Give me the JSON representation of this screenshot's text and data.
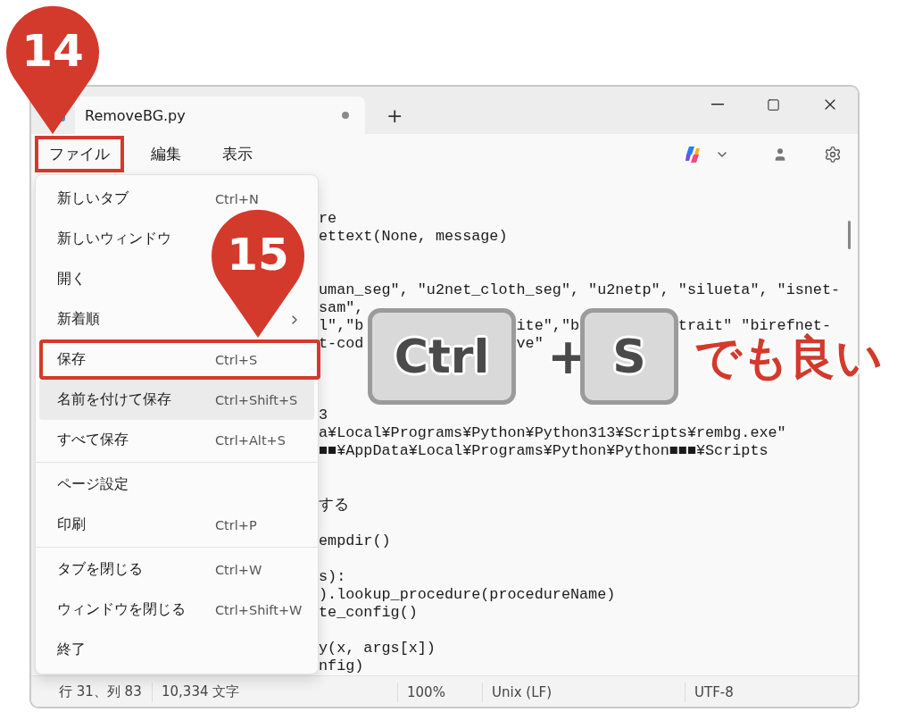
{
  "window": {
    "tab": {
      "title": "RemoveBG.py",
      "unsaved": true
    },
    "new_tab": "+"
  },
  "menubar": [
    {
      "label": "ファイル",
      "outlined": true
    },
    {
      "label": "編集",
      "outlined": false
    },
    {
      "label": "表示",
      "outlined": false
    }
  ],
  "file_menu": {
    "items": [
      {
        "kind": "item",
        "label": "新しいタブ",
        "shortcut": "Ctrl+N",
        "hovered": false,
        "outlined": false,
        "submenu": false
      },
      {
        "kind": "item",
        "label": "新しいウィンドウ",
        "hovered": false,
        "outlined": false,
        "submenu": false
      },
      {
        "kind": "item",
        "label": "開く",
        "hovered": false,
        "outlined": false,
        "submenu": false
      },
      {
        "kind": "item",
        "label": "新着順",
        "hovered": false,
        "outlined": false,
        "submenu": true
      },
      {
        "kind": "item",
        "label": "保存",
        "shortcut": "Ctrl+S",
        "hovered": false,
        "outlined": true,
        "submenu": false
      },
      {
        "kind": "item",
        "label": "名前を付けて保存",
        "shortcut": "Ctrl+Shift+S",
        "hovered": true,
        "outlined": false,
        "submenu": false
      },
      {
        "kind": "item",
        "label": "すべて保存",
        "shortcut": "Ctrl+Alt+S",
        "hovered": false,
        "outlined": false,
        "submenu": false
      },
      {
        "kind": "separator"
      },
      {
        "kind": "item",
        "label": "ページ設定",
        "hovered": false,
        "outlined": false,
        "submenu": false
      },
      {
        "kind": "item",
        "label": "印刷",
        "shortcut": "Ctrl+P",
        "hovered": false,
        "outlined": false,
        "submenu": false
      },
      {
        "kind": "separator"
      },
      {
        "kind": "item",
        "label": "タブを閉じる",
        "shortcut": "Ctrl+W",
        "hovered": false,
        "outlined": false,
        "submenu": false
      },
      {
        "kind": "item",
        "label": "ウィンドウを閉じる",
        "shortcut": "Ctrl+Shift+W",
        "hovered": false,
        "outlined": false,
        "submenu": false
      },
      {
        "kind": "item",
        "label": "終了",
        "hovered": false,
        "outlined": false,
        "submenu": false
      }
    ]
  },
  "editor": {
    "lines": [
      {
        "kind": "code",
        "text": "re"
      },
      {
        "kind": "code",
        "text": "ettext(None, message)"
      },
      {
        "kind": "blank"
      },
      {
        "kind": "blank"
      },
      {
        "kind": "code",
        "text": "uman_seg\", \"u2net_cloth_seg\", \"u2netp\", \"silueta\", \"isnet-"
      },
      {
        "kind": "code",
        "text": "sam\","
      },
      {
        "kind": "code",
        "text": "l\",\"b                 ite\",\"b           trait\" \"birefnet-"
      },
      {
        "kind": "code",
        "text": "t-cod                 ve\""
      },
      {
        "kind": "blank"
      },
      {
        "kind": "blank"
      },
      {
        "kind": "blank"
      },
      {
        "kind": "code",
        "text": "3"
      },
      {
        "kind": "code",
        "text": "a¥Local¥Programs¥Python¥Python313¥Scripts¥rembg.exe\""
      },
      {
        "kind": "code",
        "text": "■■¥AppData¥Local¥Programs¥Python¥Python■■■¥Scripts"
      },
      {
        "kind": "blank"
      },
      {
        "kind": "blank"
      },
      {
        "kind": "code",
        "text": "する"
      },
      {
        "kind": "blank"
      },
      {
        "kind": "code",
        "text": "empdir()"
      },
      {
        "kind": "blank"
      },
      {
        "kind": "code",
        "text": "s):"
      },
      {
        "kind": "code",
        "text": ").lookup_procedure(procedureName)"
      },
      {
        "kind": "code",
        "text": "te_config()"
      },
      {
        "kind": "blank"
      },
      {
        "kind": "code",
        "text": "y(x, args[x])"
      },
      {
        "kind": "code",
        "text": "nfig)"
      }
    ]
  },
  "status_bar": [
    "行 31、列 83",
    "10,334 文字",
    "100%",
    "Unix (LF)",
    "UTF-8"
  ],
  "annotations": {
    "steps": [
      "14",
      "15"
    ],
    "keys": [
      "Ctrl",
      "S"
    ],
    "plus": "+",
    "note": "でも良い"
  }
}
